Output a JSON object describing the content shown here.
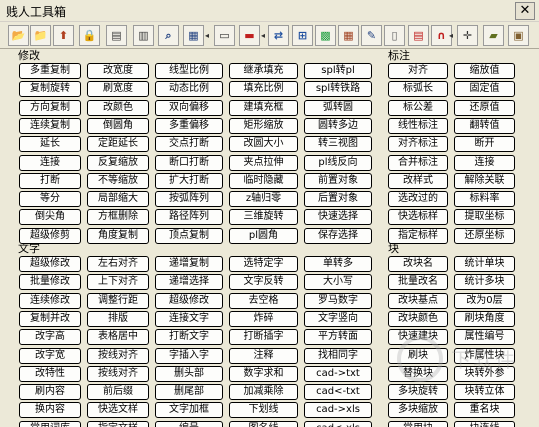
{
  "window": {
    "title": "贱人工具箱",
    "close_glyph": "✕"
  },
  "toolbar": {
    "icons": [
      {
        "name": "open-folder-icon",
        "glyph": "📂",
        "color": "#c89b2a"
      },
      {
        "name": "open-file-icon",
        "glyph": "📁",
        "color": "#c89b2a"
      },
      {
        "name": "export-icon",
        "glyph": "⬆",
        "color": "#b04020"
      },
      {
        "name": "lock-icon",
        "glyph": "🔒",
        "color": "#806000"
      },
      {
        "name": "printer-icon",
        "glyph": "▤",
        "color": "#404040"
      },
      {
        "name": "ruler-icon",
        "glyph": "▥",
        "color": "#404040"
      },
      {
        "name": "magnifier-icon",
        "glyph": "⌕",
        "color": "#204080"
      },
      {
        "name": "layout-icon",
        "glyph": "▦",
        "color": "#204080"
      },
      {
        "name": "rect-frame-icon",
        "glyph": "▭",
        "color": "#303030"
      },
      {
        "name": "layer-icon",
        "glyph": "▬",
        "color": "#c02020"
      },
      {
        "name": "transfer-icon",
        "glyph": "⇄",
        "color": "#2050a0"
      },
      {
        "name": "dimension-icon",
        "glyph": "⊞",
        "color": "#2050a0"
      },
      {
        "name": "color-palette-icon",
        "glyph": "▩",
        "color": "#20a040"
      },
      {
        "name": "grid-icon",
        "glyph": "▦",
        "color": "#a04020"
      },
      {
        "name": "edit-text-icon",
        "glyph": "✎",
        "color": "#204080"
      },
      {
        "name": "document-icon",
        "glyph": "▯",
        "color": "#606060"
      },
      {
        "name": "table-icon",
        "glyph": "▤",
        "color": "#c02020"
      },
      {
        "name": "magnet-icon",
        "glyph": "∩",
        "color": "#c02020"
      },
      {
        "name": "crosshair-icon",
        "glyph": "✛",
        "color": "#303030"
      },
      {
        "name": "truck-icon",
        "glyph": "▰",
        "color": "#607020"
      },
      {
        "name": "clipboard-icon",
        "glyph": "▣",
        "color": "#806030"
      }
    ]
  },
  "sections": {
    "modify": {
      "label": "修改",
      "rows": [
        [
          "多重复制",
          "改宽度",
          "线型比例",
          "继承填充",
          "spl转pl"
        ],
        [
          "复制旋转",
          "刷宽度",
          "动态比例",
          "填充比例",
          "spl转铁路"
        ],
        [
          "方向复制",
          "改颜色",
          "双向偏移",
          "建填充框",
          "弧转圆"
        ],
        [
          "连续复制",
          "倒圆角",
          "多重偏移",
          "矩形缩放",
          "圆转多边"
        ],
        [
          "延长",
          "定距延长",
          "交点打断",
          "改圆大小",
          "转三视图"
        ],
        [
          "连接",
          "反复缩放",
          "断口打断",
          "夹点拉伸",
          "pl线反向"
        ],
        [
          "打断",
          "不等缩放",
          "扩大打断",
          "临时隐藏",
          "前置对象"
        ],
        [
          "等分",
          "局部缩大",
          "按弧阵列",
          "z轴归零",
          "后置对象"
        ],
        [
          "倒尖角",
          "方框删除",
          "路径阵列",
          "三维旋转",
          "快速选择"
        ],
        [
          "超级修剪",
          "角度复制",
          "顶点复制",
          "pl圆角",
          "保存选择"
        ]
      ]
    },
    "annotate": {
      "label": "标注",
      "rows": [
        [
          "对齐",
          "缩放值"
        ],
        [
          "标弧长",
          "固定值"
        ],
        [
          "标公差",
          "还原值"
        ],
        [
          "线性标注",
          "翻转值"
        ],
        [
          "对齐标注",
          "断开"
        ],
        [
          "合并标注",
          "连接"
        ],
        [
          "改样式",
          "解除关联"
        ],
        [
          "选改过的",
          "标料率"
        ],
        [
          "快选标样",
          "提取坐标"
        ],
        [
          "指定标样",
          "还原坐标"
        ]
      ]
    },
    "text": {
      "label": "文字",
      "rows": [
        [
          "超级修改",
          "左右对齐",
          "递增复制",
          "选特定字",
          "单转多"
        ],
        [
          "批量修改",
          "上下对齐",
          "递增选择",
          "文字反转",
          "大小写"
        ],
        [
          "连续修改",
          "调整行距",
          "超级修改",
          "去空格",
          "罗马数字"
        ],
        [
          "复制并改",
          "排版",
          "连接文字",
          "炸碎",
          "文字竖向"
        ],
        [
          "改字高",
          "表格居中",
          "打断文字",
          "打断插字",
          "平方转面"
        ],
        [
          "改字宽",
          "按线对齐",
          "字插入字",
          "注释",
          "找相同字"
        ],
        [
          "改特性",
          "按线对齐",
          "删头部",
          "数字求和",
          "cad->txt"
        ],
        [
          "刷内容",
          "前后缀",
          "删尾部",
          "加减乘除",
          "cad<-txt"
        ],
        [
          "换内容",
          "快选文样",
          "文字加框",
          "下划线",
          "cad->xls"
        ],
        [
          "常用词库",
          "指定文样",
          "编号",
          "图名线",
          "cad<-xls"
        ]
      ]
    },
    "block": {
      "label": "块",
      "rows": [
        [
          "改块名",
          "统计单块"
        ],
        [
          "批量改名",
          "统计多块"
        ],
        [
          "改块基点",
          "改为0层"
        ],
        [
          "改块颜色",
          "刷块角度"
        ],
        [
          "快速建块",
          "属性编号"
        ],
        [
          "刷块",
          "炸属性块"
        ],
        [
          "替换块",
          "块转外参"
        ],
        [
          "多块旋转",
          "块转立体"
        ],
        [
          "多块缩放",
          "重名块"
        ],
        [
          "常用块",
          "块连线"
        ]
      ]
    }
  },
  "watermark": {
    "text": "下软件"
  }
}
